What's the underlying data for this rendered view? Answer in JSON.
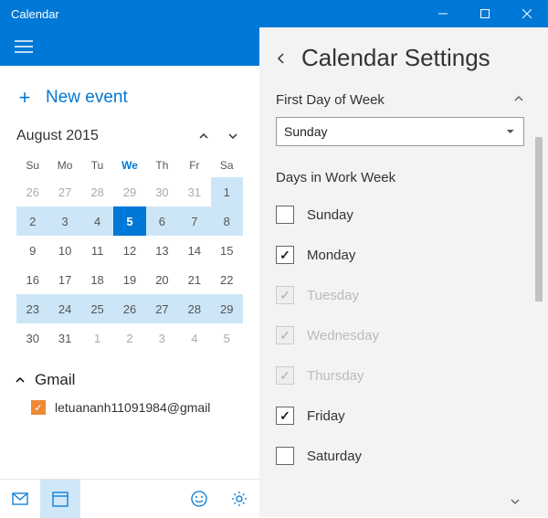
{
  "window": {
    "title": "Calendar"
  },
  "sidebar": {
    "new_event": "New event",
    "month_title": "August 2015",
    "dow": [
      "Su",
      "Mo",
      "Tu",
      "We",
      "Th",
      "Fr",
      "Sa"
    ],
    "today_dow_index": 3,
    "days": [
      {
        "n": "26",
        "other": true
      },
      {
        "n": "27",
        "other": true
      },
      {
        "n": "28",
        "other": true
      },
      {
        "n": "29",
        "other": true
      },
      {
        "n": "30",
        "other": true
      },
      {
        "n": "31",
        "other": true
      },
      {
        "n": "1",
        "range": true
      },
      {
        "n": "2",
        "range": true
      },
      {
        "n": "3",
        "range": true
      },
      {
        "n": "4",
        "range": true
      },
      {
        "n": "5",
        "selected": true
      },
      {
        "n": "6",
        "range": true
      },
      {
        "n": "7",
        "range": true
      },
      {
        "n": "8",
        "range": true
      },
      {
        "n": "9"
      },
      {
        "n": "10"
      },
      {
        "n": "11"
      },
      {
        "n": "12"
      },
      {
        "n": "13"
      },
      {
        "n": "14"
      },
      {
        "n": "15"
      },
      {
        "n": "16"
      },
      {
        "n": "17"
      },
      {
        "n": "18"
      },
      {
        "n": "19"
      },
      {
        "n": "20"
      },
      {
        "n": "21"
      },
      {
        "n": "22"
      },
      {
        "n": "23",
        "range": true
      },
      {
        "n": "24",
        "range": true
      },
      {
        "n": "25",
        "range": true
      },
      {
        "n": "26",
        "range": true
      },
      {
        "n": "27",
        "range": true
      },
      {
        "n": "28",
        "range": true
      },
      {
        "n": "29",
        "range": true
      },
      {
        "n": "30"
      },
      {
        "n": "31"
      },
      {
        "n": "1",
        "other": true
      },
      {
        "n": "2",
        "other": true
      },
      {
        "n": "3",
        "other": true
      },
      {
        "n": "4",
        "other": true
      },
      {
        "n": "5",
        "other": true
      }
    ],
    "account_group": "Gmail",
    "account_email": "letuananh11091984@gmail"
  },
  "settings": {
    "title": "Calendar Settings",
    "first_day_label": "First Day of Week",
    "first_day_value": "Sunday",
    "work_week_label": "Days in Work Week",
    "days": [
      {
        "label": "Sunday",
        "checked": false,
        "disabled": false
      },
      {
        "label": "Monday",
        "checked": true,
        "disabled": false
      },
      {
        "label": "Tuesday",
        "checked": true,
        "disabled": true
      },
      {
        "label": "Wednesday",
        "checked": true,
        "disabled": true
      },
      {
        "label": "Thursday",
        "checked": true,
        "disabled": true
      },
      {
        "label": "Friday",
        "checked": true,
        "disabled": false
      },
      {
        "label": "Saturday",
        "checked": false,
        "disabled": false
      }
    ]
  }
}
